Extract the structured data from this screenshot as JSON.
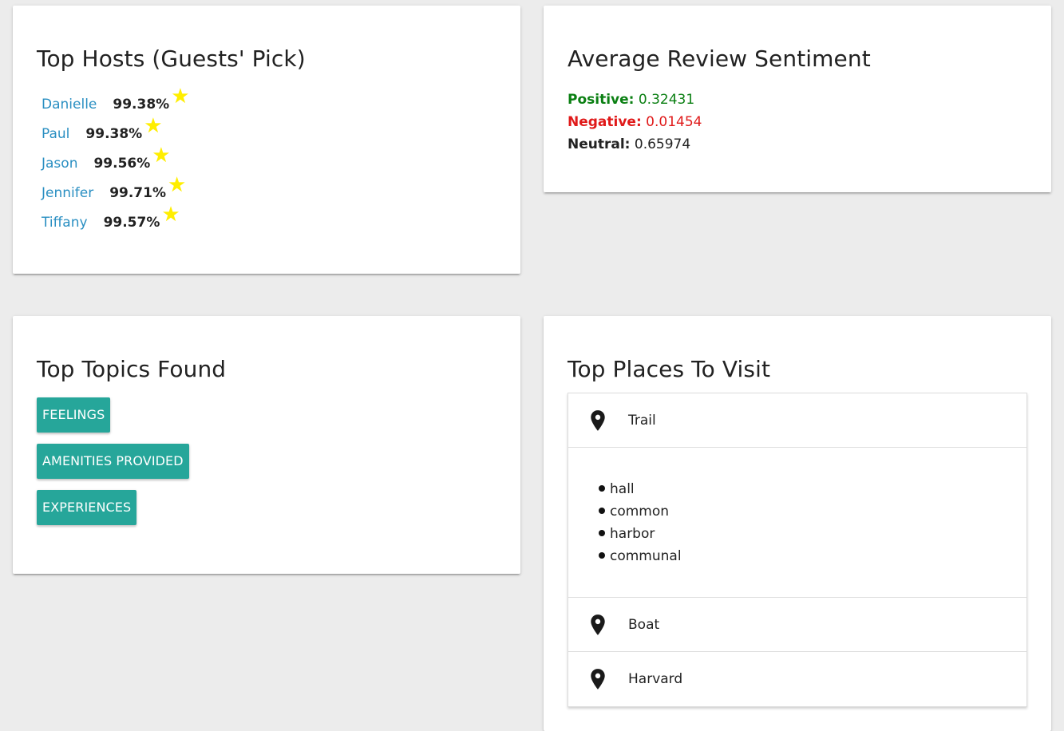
{
  "hosts_card": {
    "title": "Top Hosts (Guests' Pick)",
    "hosts": [
      {
        "name": "Danielle",
        "score": "99.38%",
        "icon": "star-icon"
      },
      {
        "name": "Paul",
        "score": "99.38%",
        "icon": "star-icon"
      },
      {
        "name": "Jason",
        "score": "99.56%",
        "icon": "star-icon"
      },
      {
        "name": "Jennifer",
        "score": "99.71%",
        "icon": "star-icon"
      },
      {
        "name": "Tiffany",
        "score": "99.57%",
        "icon": "star-icon"
      }
    ],
    "star_color": "#ffee00",
    "name_color": "#2a8fc2"
  },
  "sentiment_card": {
    "title": "Average Review Sentiment",
    "positive": {
      "label": "Positive:",
      "value": "0.32431",
      "color": "#0a7f12"
    },
    "negative": {
      "label": "Negative:",
      "value": "0.01454",
      "color": "#e01a1a"
    },
    "neutral": {
      "label": "Neutral:",
      "value": "0.65974",
      "color": "#222222"
    }
  },
  "topics_card": {
    "title": "Top Topics Found",
    "topics": [
      "FEELINGS",
      "AMENITIES PROVIDED",
      "EXPERIENCES"
    ],
    "chip_color": "#26a69a"
  },
  "places_card": {
    "title": "Top Places To Visit",
    "places": [
      {
        "label": "Trail",
        "icon": "place-pin-icon",
        "expanded": true,
        "items": [
          "hall",
          "common",
          "harbor",
          "communal"
        ]
      },
      {
        "label": "Boat",
        "icon": "place-pin-icon",
        "expanded": false
      },
      {
        "label": "Harvard",
        "icon": "place-pin-icon",
        "expanded": false
      }
    ]
  }
}
